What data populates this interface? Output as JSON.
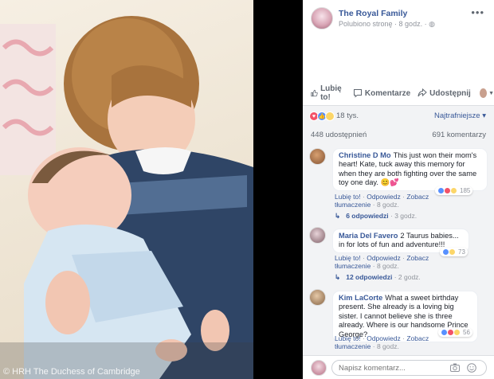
{
  "photo": {
    "credit": "© HRH The Duchess of Cambridge"
  },
  "post": {
    "page_name": "The Royal Family",
    "meta": "Polubiono stronę · 8 godz. · ",
    "more_icon": "more-dots-icon"
  },
  "actions": {
    "like": "Lubię to!",
    "comment": "Komentarze",
    "share": "Udostępnij"
  },
  "reactions": {
    "count": "18 tys.",
    "types": [
      "heart",
      "like",
      "wow"
    ],
    "sort_label": "Najtrafniejsze"
  },
  "stats": {
    "shares": "448 udostępnień",
    "comments": "691 komentarzy"
  },
  "comments": [
    {
      "author": "Christine D Mo",
      "text": "This just won their mom's heart! Kate, tuck away this memory for when they are both fighting over the same toy one day. 😊💕",
      "reaction_count": "185",
      "like": "Lubię to!",
      "reply": "Odpowiedz",
      "translate": "Zobacz tłumaczenie",
      "time": "8 godz.",
      "replies": "6 odpowiedzi",
      "replies_time": "3 godz."
    },
    {
      "author": "Maria Del Favero",
      "text": "2 Taurus babies... in for lots of fun and adventure!!!",
      "reaction_count": "73",
      "like": "Lubię to!",
      "reply": "Odpowiedz",
      "translate": "Zobacz tłumaczenie",
      "time": "8 godz.",
      "replies": "12 odpowiedzi",
      "replies_time": "2 godz."
    },
    {
      "author": "Kim LaCorte",
      "text": "What a sweet birthday present. She already is a loving big sister. I cannot believe she is three already. Where is our handsome Prince George?",
      "reaction_count": "56",
      "like": "Lubię to!",
      "reply": "Odpowiedz",
      "translate": "Zobacz tłumaczenie",
      "time": "8 godz."
    }
  ],
  "composer": {
    "placeholder": "Napisz komentarz..."
  },
  "colors": {
    "link": "#385898",
    "like_blue": "#5890ff",
    "love_red": "#f25268",
    "wow_yellow": "#fcd669"
  }
}
